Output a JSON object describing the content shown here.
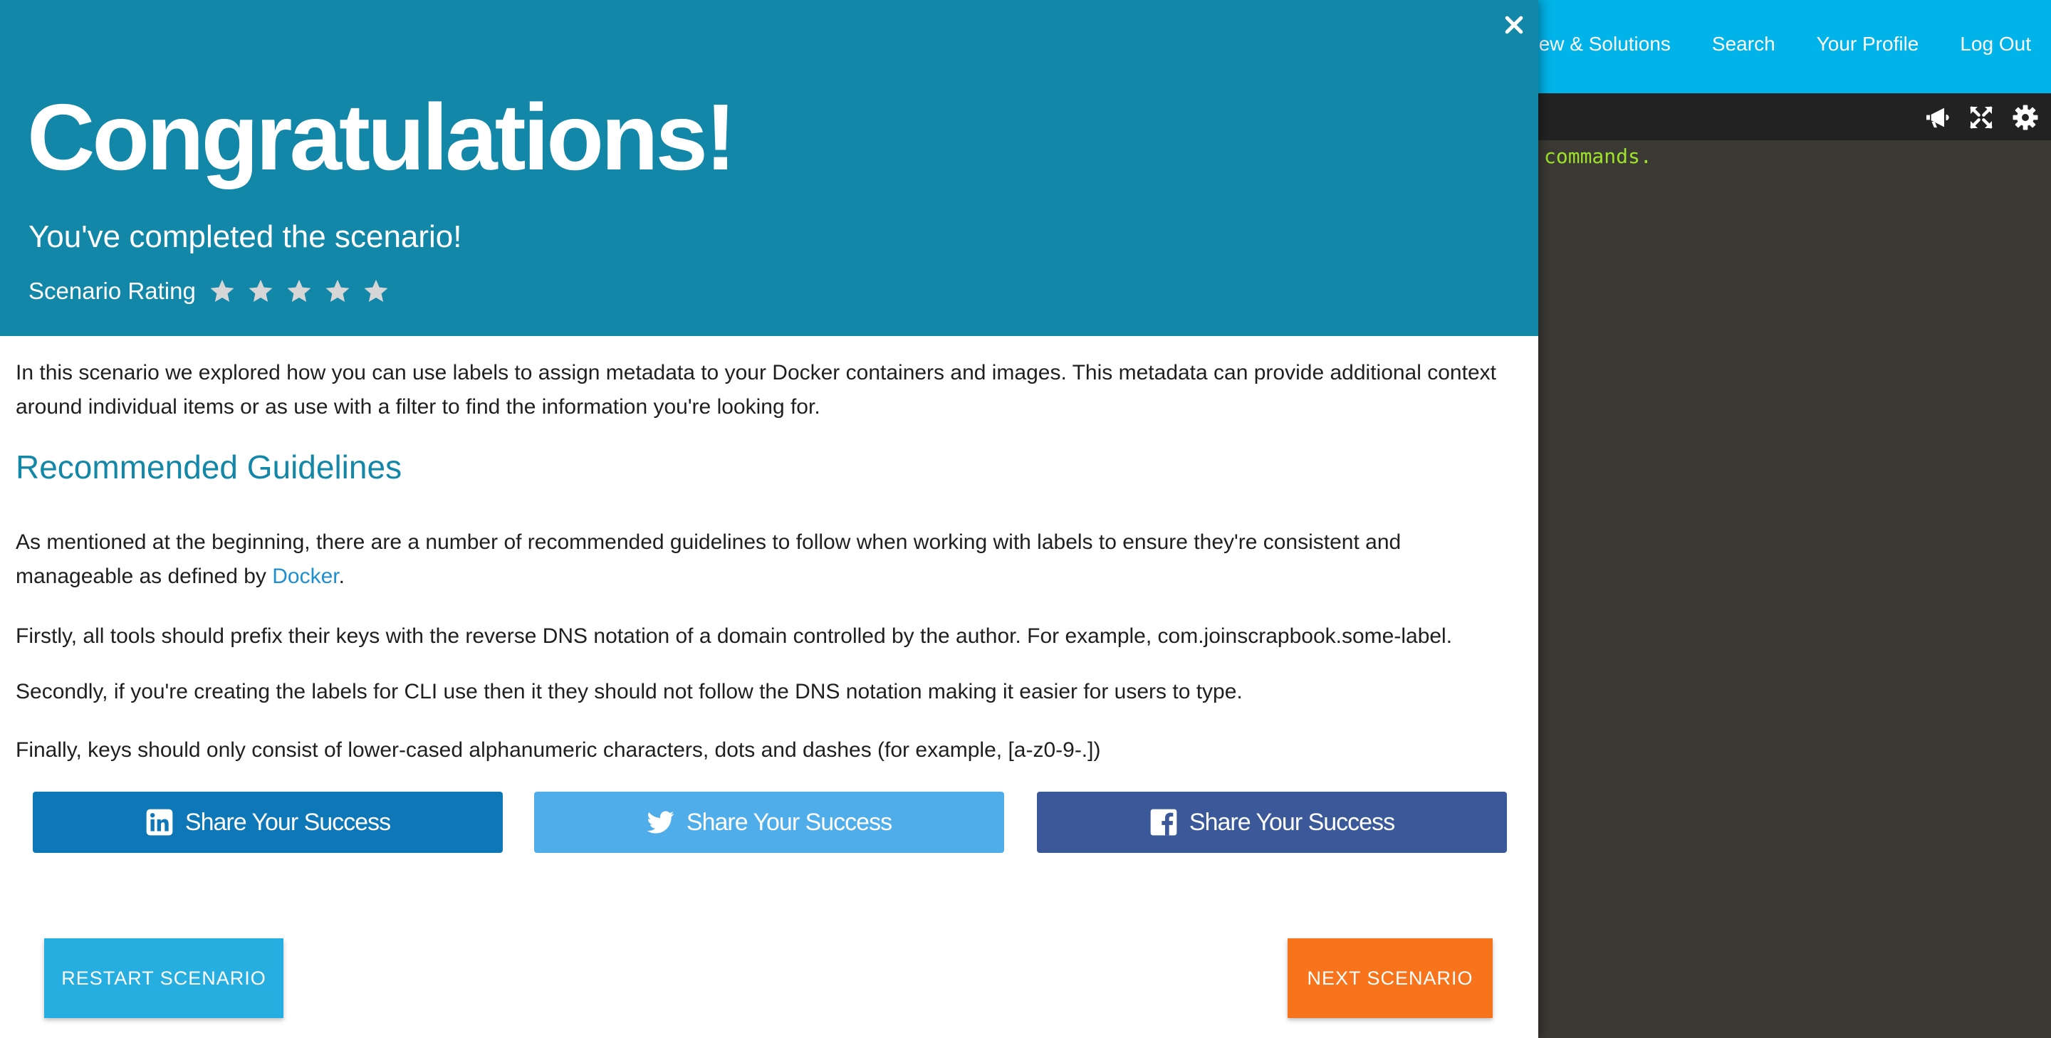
{
  "nav": {
    "items": [
      "ew & Solutions",
      "Search",
      "Your Profile",
      "Log Out"
    ]
  },
  "terminal": {
    "toolbar_icons": [
      "megaphone-icon",
      "expand-icon",
      "gear-icon"
    ],
    "text": "commands."
  },
  "modal": {
    "close_icon": "close-icon",
    "title": "Congratulations!",
    "subtitle": "You've completed the scenario!",
    "rating_label": "Scenario Rating",
    "rating_stars": 5,
    "intro": "In this scenario we explored how you can use labels to assign metadata to your Docker containers and images. This metadata can provide additional context around individual items or as use with a filter to find the information you're looking for.",
    "heading": "Recommended Guidelines",
    "para2_before": "As mentioned at the beginning, there are a number of recommended guidelines to follow when working with labels to ensure they're consistent and manageable as defined by ",
    "para2_link": "Docker",
    "para2_after": ".",
    "para3": "Firstly, all tools should prefix their keys with the reverse DNS notation of a domain controlled by the author. For example, com.joinscrapbook.some-label.",
    "para4": "Secondly, if you're creating the labels for CLI use then it they should not follow the DNS notation making it easier for users to type.",
    "para5": "Finally, keys should only consist of lower-cased alphanumeric characters, dots and dashes (for example, [a-z0-9-.])",
    "share": {
      "linkedin_label": "Share Your Success",
      "twitter_label": "Share Your Success",
      "facebook_label": "Share Your Success"
    },
    "restart_label": "RESTART SCENARIO",
    "next_label": "NEXT SCENARIO"
  },
  "colors": {
    "header": "#1387a8",
    "nav": "#00b3e8",
    "linkedin": "#0d77b7",
    "twitter": "#4fadea",
    "facebook": "#3b5998",
    "restart": "#27aee0",
    "next": "#f7741c",
    "terminal_text": "#9fe22a"
  }
}
